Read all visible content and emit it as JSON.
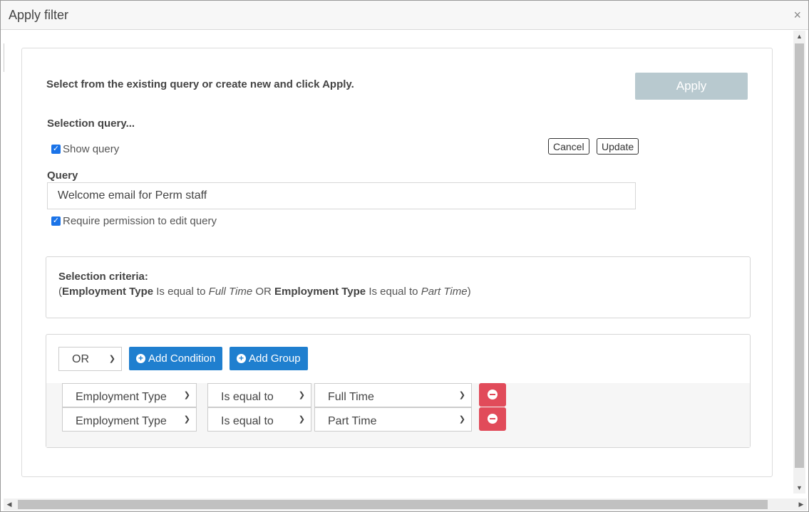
{
  "window": {
    "title": "Apply filter",
    "close_glyph": "×"
  },
  "form": {
    "instruction": "Select from the existing query or create new and click Apply.",
    "apply_label": "Apply",
    "selection_query_label": "Selection query...",
    "show_query": {
      "label": "Show query",
      "checked": true
    },
    "cancel_label": "Cancel",
    "update_label": "Update",
    "query_label": "Query",
    "query_value": "Welcome email for Perm staff",
    "require_permission": {
      "label": "Require permission to edit query",
      "checked": true
    }
  },
  "criteria": {
    "title": "Selection criteria:",
    "open_paren": "(",
    "close_paren": ")",
    "cond1": {
      "field": "Employment Type",
      "op": "Is equal to",
      "value": "Full Time"
    },
    "joiner": "OR",
    "cond2": {
      "field": "Employment Type",
      "op": "Is equal to",
      "value": "Part Time"
    }
  },
  "builder": {
    "group_operator": "OR",
    "add_condition_label": "Add Condition",
    "add_group_label": "Add Group",
    "rows": [
      {
        "field": "Employment Type",
        "operator": "Is equal to",
        "value": "Full Time"
      },
      {
        "field": "Employment Type",
        "operator": "Is equal to",
        "value": "Part Time"
      }
    ]
  },
  "colors": {
    "accent_blue": "#1f7fcf",
    "danger_red": "#e14b5a",
    "apply_disabled": "#b8c9cf",
    "checkbox_blue": "#1a73e8"
  },
  "icons": {
    "close": "close-icon",
    "plus": "plus-circle-icon",
    "minus": "minus-circle-icon",
    "chevron": "chevron-down-icon",
    "check": "checkmark-icon"
  }
}
